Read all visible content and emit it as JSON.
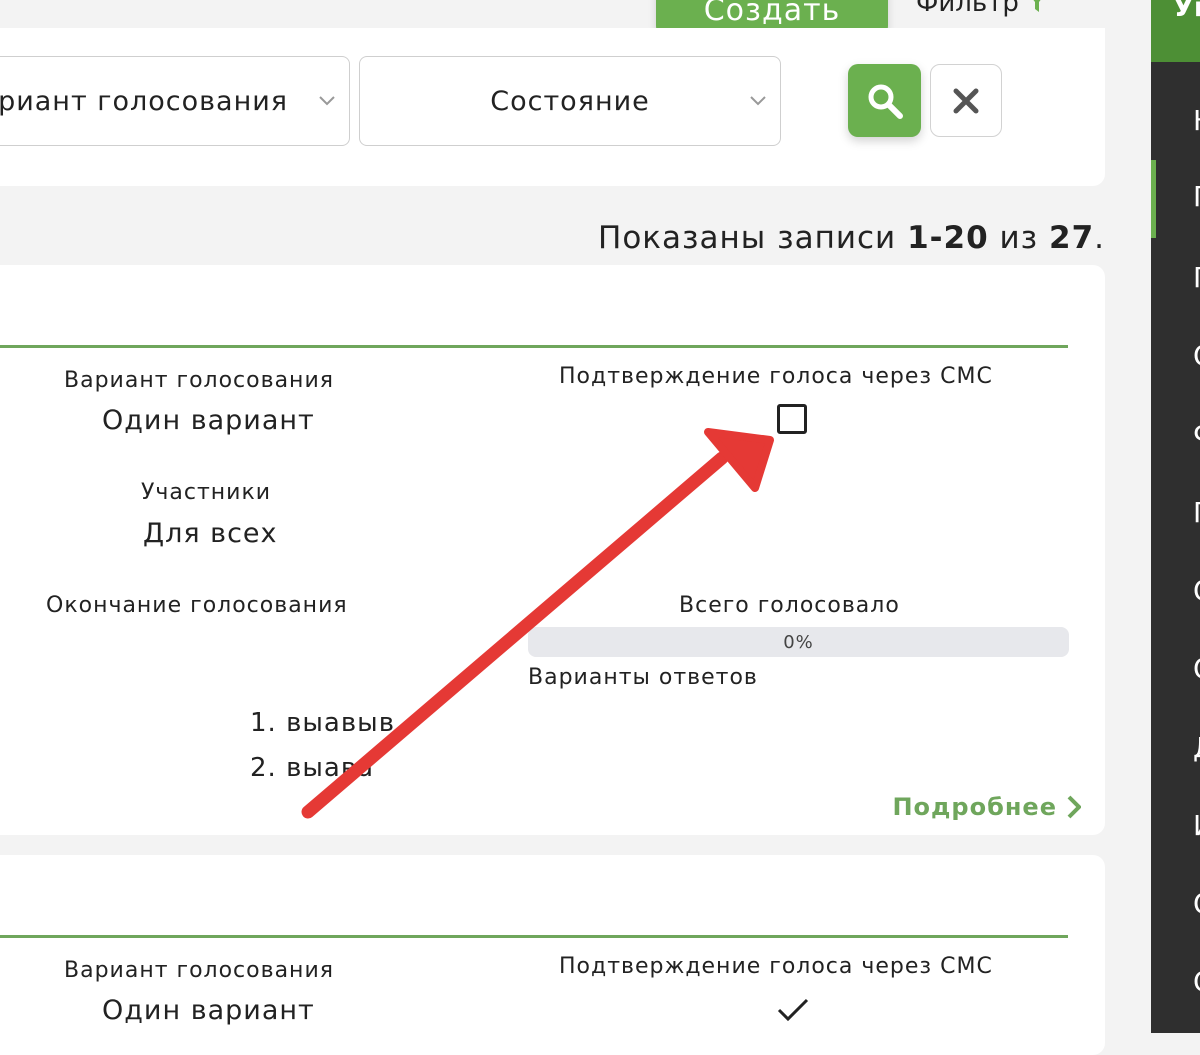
{
  "header": {
    "create_label": "Создать",
    "filter_label": "Фильтр"
  },
  "filters": {
    "variant_label": "Вариант голосования",
    "state_label": "Состояние"
  },
  "records": {
    "prefix": "Показаны записи",
    "range": "1-20",
    "middle": "из",
    "total": "27",
    "suffix": "."
  },
  "card1": {
    "variant_label": "Вариант голосования",
    "variant_value": "Один вариант",
    "sms_label": "Подтверждение голоса через СМС",
    "sms_checked": false,
    "participants_label": "Участники",
    "participants_value": "Для всех",
    "end_label": "Окончание голосования",
    "total_label": "Всего голосовало",
    "progress_percent": 0,
    "progress_text": "0%",
    "answers_label": "Варианты ответов",
    "answers": [
      "1. выавыв",
      "2. выава"
    ],
    "more_label": "Подробнее"
  },
  "card2": {
    "variant_label": "Вариант голосования",
    "variant_value": "Один вариант",
    "sms_label": "Подтверждение голоса через СМС",
    "sms_checked": true
  },
  "sidebar": {
    "header": "Уп",
    "items": [
      "Н",
      "П",
      "П",
      "О",
      "Ф",
      "П",
      "О",
      "О",
      "Д",
      "И",
      "О",
      "С"
    ]
  },
  "colors": {
    "accent": "#6bb04f",
    "accent_line": "#6fa65c",
    "sidebar_bg": "#2f2f2f",
    "annotation_arrow": "#e53935"
  }
}
